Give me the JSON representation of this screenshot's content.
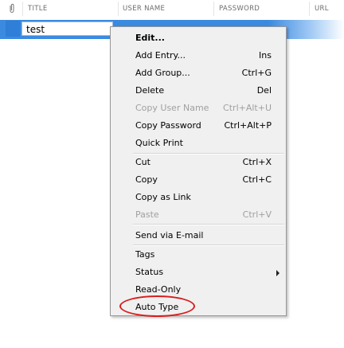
{
  "header": {
    "columns": [
      "TITLE",
      "USER NAME",
      "PASSWORD",
      "URL"
    ]
  },
  "entry": {
    "title": "test"
  },
  "context_menu": {
    "items": [
      {
        "label": "Edit...",
        "shortcut": "",
        "bold": true
      },
      {
        "label": "Add Entry...",
        "shortcut": "Ins"
      },
      {
        "label": "Add Group...",
        "shortcut": "Ctrl+G"
      },
      {
        "label": "Delete",
        "shortcut": "Del"
      },
      {
        "label": "Copy User Name",
        "shortcut": "Ctrl+Alt+U",
        "disabled": true
      },
      {
        "label": "Copy Password",
        "shortcut": "Ctrl+Alt+P"
      },
      {
        "label": "Quick Print",
        "shortcut": ""
      },
      {
        "label": "Cut",
        "shortcut": "Ctrl+X"
      },
      {
        "label": "Copy",
        "shortcut": "Ctrl+C"
      },
      {
        "label": "Copy as Link",
        "shortcut": ""
      },
      {
        "label": "Paste",
        "shortcut": "Ctrl+V",
        "disabled": true
      },
      {
        "label": "Send via E-mail",
        "shortcut": ""
      },
      {
        "label": "Tags",
        "shortcut": ""
      },
      {
        "label": "Status",
        "shortcut": "",
        "submenu": true
      },
      {
        "label": "Read-Only",
        "shortcut": ""
      },
      {
        "label": "Auto Type",
        "shortcut": "",
        "highlighted": true
      }
    ]
  },
  "colors": {
    "selection": "#3a8ae0",
    "highlight_ring": "#d81e1e",
    "menu_background": "#f0f0f0"
  }
}
